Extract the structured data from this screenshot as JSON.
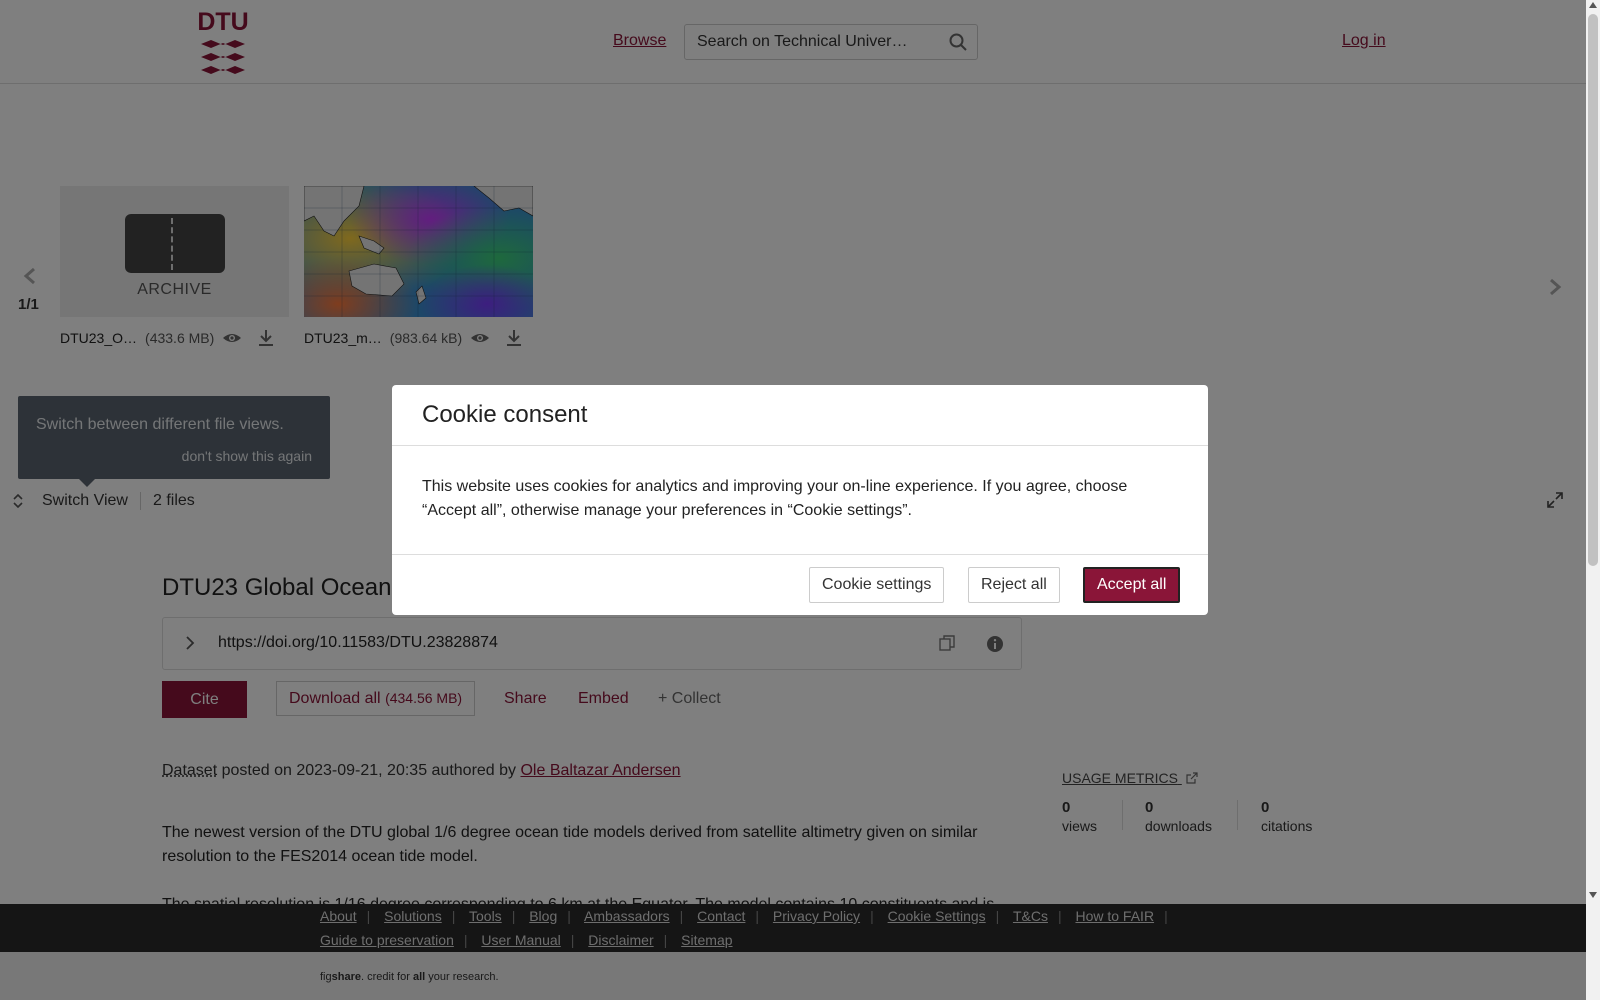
{
  "header": {
    "logo_text": "DTU",
    "browse_label": "Browse",
    "search_placeholder": "Search on Technical Univer…",
    "login_label": "Log in"
  },
  "viewer": {
    "page_count": "1/1",
    "files": [
      {
        "name": "DTU23_O…",
        "size": "(433.6 MB)",
        "preview_label": "ARCHIVE"
      },
      {
        "name": "DTU23_m…",
        "size": "(983.64 kB)"
      }
    ],
    "tooltip_text": "Switch between different file views.",
    "tooltip_dismiss": "don't show this again",
    "switch_view_label": "Switch View",
    "files_count": "2 files"
  },
  "item": {
    "title": "DTU23 Global Ocean",
    "doi": "https://doi.org/10.11583/DTU.23828874",
    "cite_label": "Cite",
    "download_label": "Download all",
    "download_size": "(434.56 MB)",
    "share_label": "Share",
    "embed_label": "Embed",
    "collect_label": "+ Collect",
    "posted": {
      "type": "Dataset",
      "text": " posted on 2023-09-21, 20:35 authored by ",
      "author": "Ole Baltazar Andersen"
    },
    "description_1": "The newest version of the DTU global 1/6 degree ocean tide models derived from satellite altimetry given on similar resolution to the FES2014 ocean tide model.",
    "description_2": "The spatial resolution is 1/16 degree corresponding to 6 km at the Equator. The model contains 10 constituents and is"
  },
  "metrics": {
    "usage_label": "USAGE METRICS",
    "views": {
      "value": "0",
      "label": "views"
    },
    "downloads": {
      "value": "0",
      "label": "downloads"
    },
    "citations": {
      "value": "0",
      "label": "citations"
    }
  },
  "footer": {
    "links_row1": [
      "About",
      "Solutions",
      "Tools",
      "Blog",
      "Ambassadors",
      "Contact",
      "Privacy Policy",
      "Cookie Settings",
      "T&Cs",
      "How to FAIR"
    ],
    "links_row2": [
      "Guide to preservation",
      "User Manual",
      "Disclaimer",
      "Sitemap"
    ],
    "tagline_pre": "fig",
    "tagline_bold1": "share",
    "tagline_mid": ". credit for ",
    "tagline_bold2": "all",
    "tagline_post": " your research."
  },
  "cookie_modal": {
    "title": "Cookie consent",
    "body": "This website uses cookies for analytics and improving your on-line experience. If you agree, choose “Accept all”, otherwise manage your preferences in “Cookie settings”.",
    "settings_label": "Cookie settings",
    "reject_label": "Reject all",
    "accept_label": "Accept all"
  },
  "colors": {
    "brand": "#8a1538",
    "overlay": "rgba(0,0,0,0.5)"
  }
}
